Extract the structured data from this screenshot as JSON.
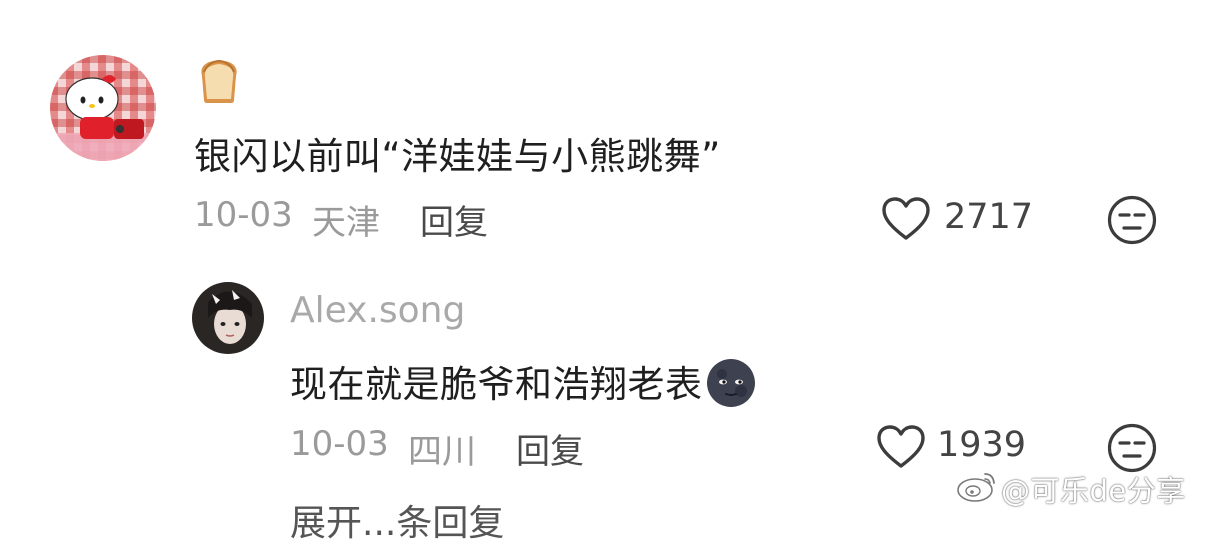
{
  "comments": [
    {
      "text": "银闪以前叫“洋娃娃与小熊跳舞”",
      "date": "10-03",
      "location": "天津",
      "reply_label": "回复",
      "likes": "2717"
    },
    {
      "username": "Alex.song",
      "text": "现在就是脆爷和浩翔老表",
      "date": "10-03",
      "location": "四川",
      "reply_label": "回复",
      "likes": "1939"
    }
  ],
  "watermark": "@可乐de分享",
  "cut_off_text": "展开...条回复",
  "icons": {
    "badge": "bread-icon",
    "like": "heart-outline-icon",
    "dislike": "unamused-face-icon",
    "emoji": "new-moon-face-icon",
    "watermark_logo": "weibo-icon"
  }
}
